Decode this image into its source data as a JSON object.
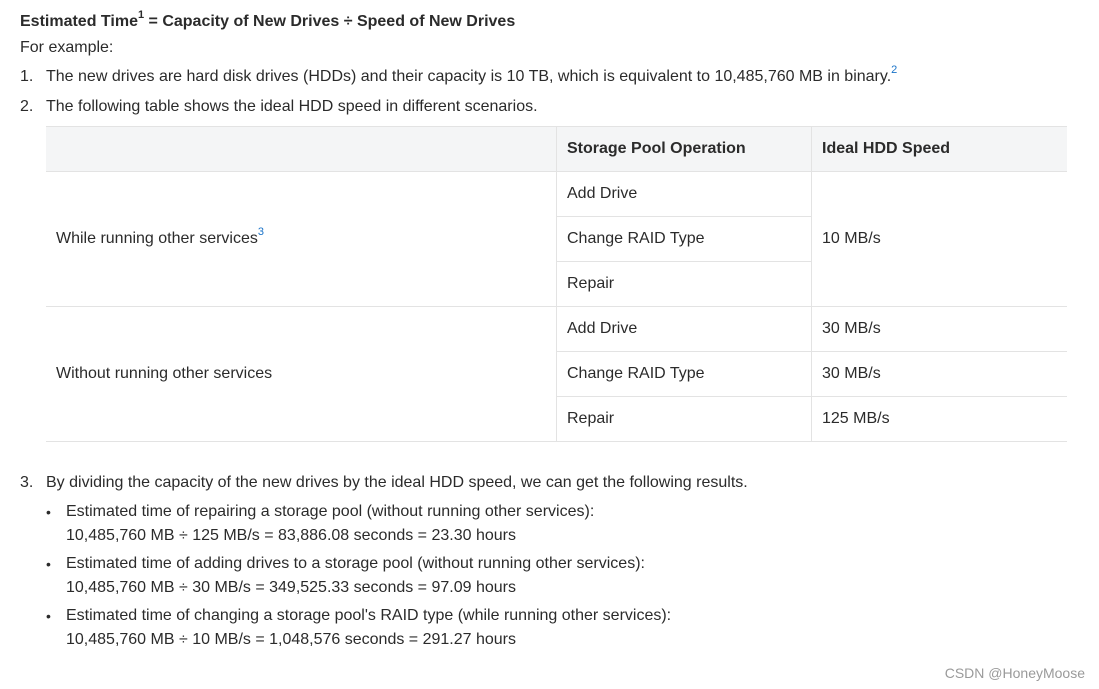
{
  "formula": {
    "label": "Estimated Time",
    "sup": "1",
    "rest": " = Capacity of New Drives ÷ Speed of New Drives"
  },
  "for_example": "For example:",
  "items": [
    {
      "num": "1.",
      "text": "The new drives are hard disk drives (HDDs) and their capacity is 10 TB, which is equivalent to 10,485,760 MB in binary.",
      "sup": "2"
    },
    {
      "num": "2.",
      "text": "The following table shows the ideal HDD speed in different scenarios."
    }
  ],
  "table": {
    "headers": [
      "",
      "Storage Pool Operation",
      "Ideal HDD Speed"
    ],
    "group1": {
      "label": "While running other services",
      "sup": "3",
      "ops": [
        "Add Drive",
        "Change RAID Type",
        "Repair"
      ],
      "speed": "10 MB/s"
    },
    "group2": {
      "label": "Without running other services",
      "ops": [
        "Add Drive",
        "Change RAID Type",
        "Repair"
      ],
      "speeds": [
        "30 MB/s",
        "30 MB/s",
        "125 MB/s"
      ]
    }
  },
  "item3": {
    "num": "3.",
    "text": "By dividing the capacity of the new drives by the ideal HDD speed, we can get the following results."
  },
  "bullets": [
    {
      "line1": "Estimated time of repairing a storage pool (without running other services):",
      "line2": "10,485,760 MB ÷ 125 MB/s = 83,886.08 seconds = 23.30 hours"
    },
    {
      "line1": "Estimated time of adding drives to a storage pool (without running other services):",
      "line2": "10,485,760 MB ÷ 30 MB/s = 349,525.33 seconds = 97.09 hours"
    },
    {
      "line1": "Estimated time of changing a storage pool's RAID type (while running other services):",
      "line2": "10,485,760 MB ÷ 10 MB/s = 1,048,576 seconds = 291.27 hours"
    }
  ],
  "watermark": "CSDN @HoneyMoose"
}
